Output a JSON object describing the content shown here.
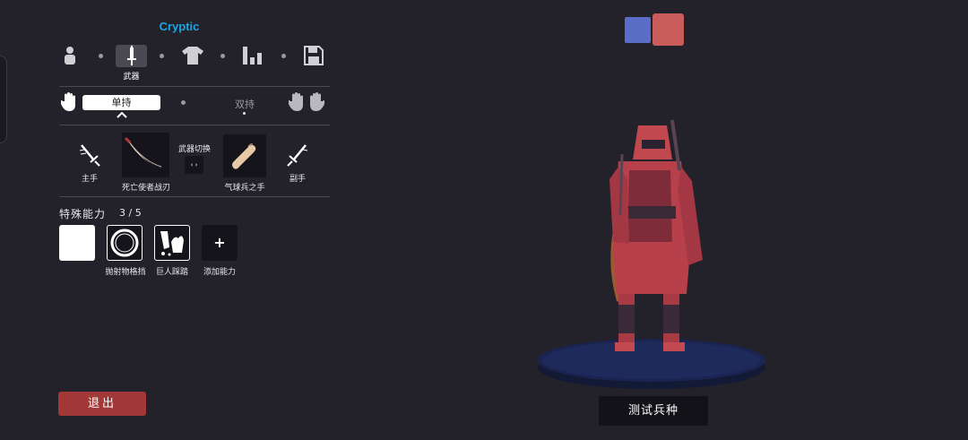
{
  "unit_name": "Cryptic",
  "nav": {
    "items": [
      {
        "name": "character",
        "icon": "person-icon"
      },
      {
        "name": "weapon",
        "icon": "sword-icon",
        "label": "武器"
      },
      {
        "name": "clothing",
        "icon": "shirt-icon"
      },
      {
        "name": "stats",
        "icon": "bars-icon"
      },
      {
        "name": "save",
        "icon": "floppy-disk-icon"
      }
    ]
  },
  "grip": {
    "single_label": "单持",
    "dual_label": "双持"
  },
  "weapons": {
    "main_hand_label": "主手",
    "main_weapon_name": "死亡使者战刃",
    "swap_label": "武器切换",
    "swap_icon": "‹ ›",
    "off_weapon_name": "气球兵之手",
    "off_hand_label": "副手"
  },
  "abilities": {
    "title": "特殊能力",
    "count": "3 / 5",
    "items": [
      {
        "name": "",
        "icon": "blank-ability"
      },
      {
        "name": "抛射物格挡",
        "icon": "ring-shield-icon"
      },
      {
        "name": "巨人踩踏",
        "icon": "stomp-icon"
      },
      {
        "name": "添加能力",
        "icon": "plus-icon"
      }
    ],
    "add_symbol": "+"
  },
  "buttons": {
    "exit_label": "退出",
    "test_label": "测试兵种"
  },
  "team_colors": {
    "blue": "#5b6ec7",
    "red": "#c95b5b"
  },
  "accent": "#1aa6e6"
}
